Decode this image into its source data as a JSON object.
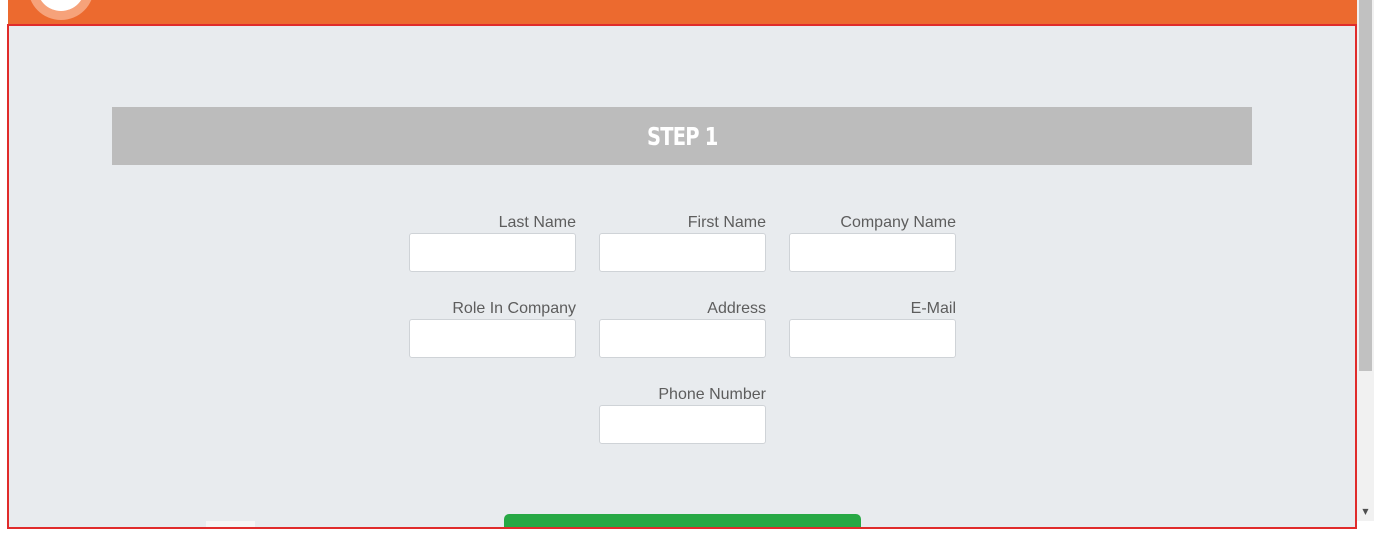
{
  "header": {
    "accent_color": "#ec6a2f"
  },
  "step": {
    "title": "STEP 1"
  },
  "form": {
    "fields": [
      {
        "label": "Last Name",
        "value": ""
      },
      {
        "label": "First Name",
        "value": ""
      },
      {
        "label": "Company Name",
        "value": ""
      },
      {
        "label": "Role In Company",
        "value": ""
      },
      {
        "label": "Address",
        "value": ""
      },
      {
        "label": "E-Mail",
        "value": ""
      },
      {
        "label": "Phone Number",
        "value": ""
      }
    ],
    "submit_color": "#27a844"
  },
  "scrollbar": {
    "down_arrow": "▼"
  }
}
